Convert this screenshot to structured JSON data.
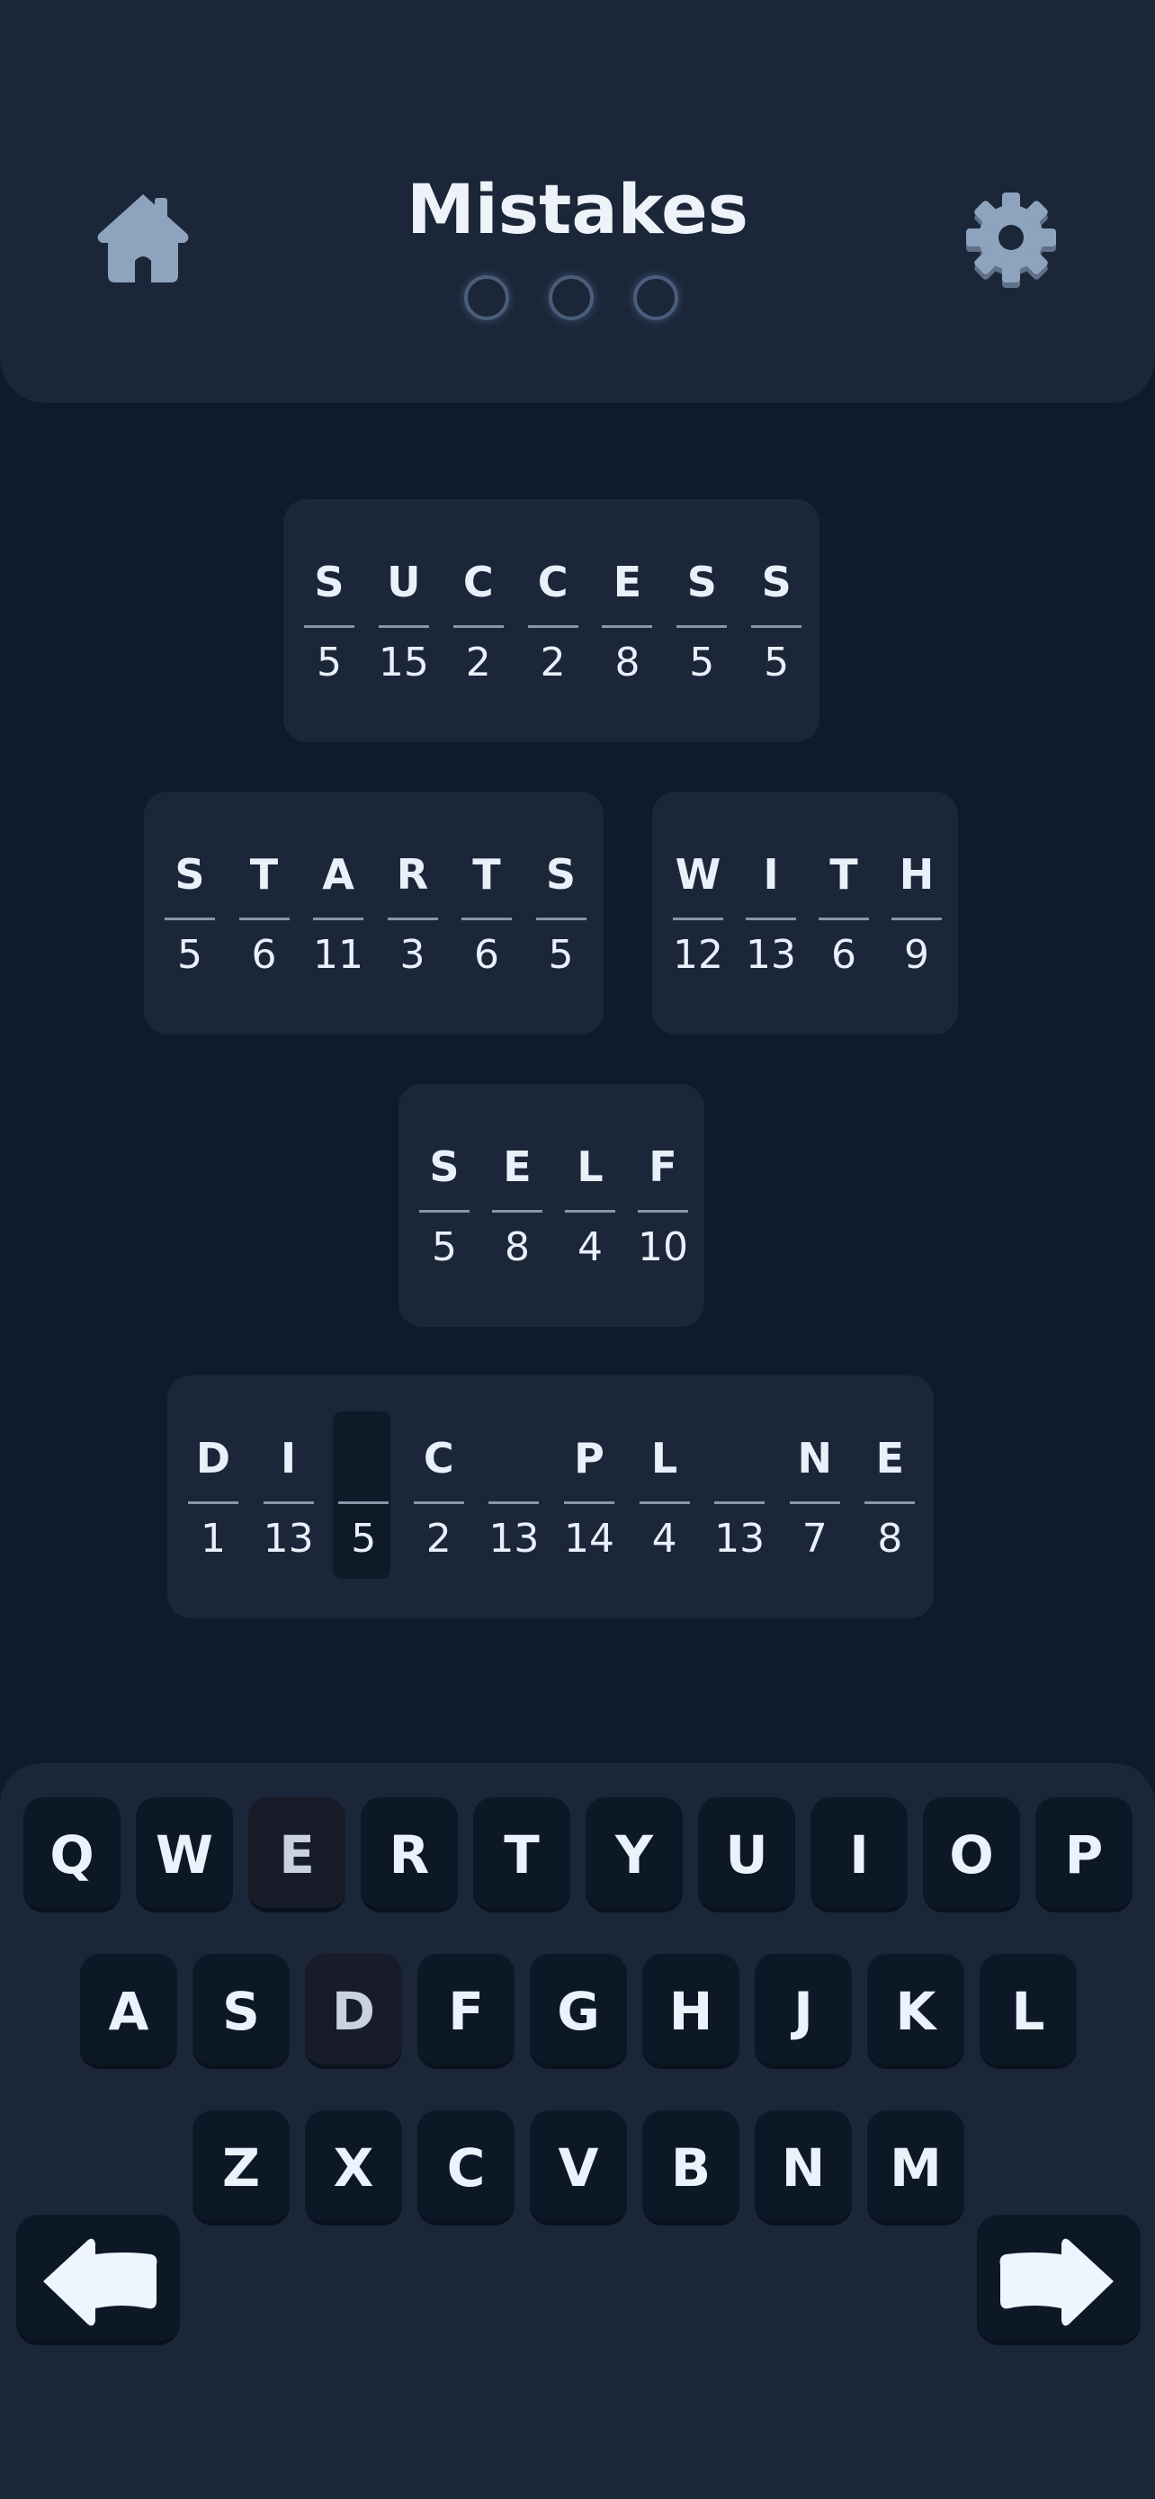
{
  "header": {
    "title": "Mistakes",
    "mistakes": [
      false,
      false,
      false
    ],
    "icons": {
      "home": "home-icon",
      "settings": "gear-icon"
    }
  },
  "puzzle": {
    "words": [
      {
        "cells": [
          {
            "letter": "S",
            "number": "5"
          },
          {
            "letter": "U",
            "number": "15"
          },
          {
            "letter": "C",
            "number": "2"
          },
          {
            "letter": "C",
            "number": "2"
          },
          {
            "letter": "E",
            "number": "8"
          },
          {
            "letter": "S",
            "number": "5"
          },
          {
            "letter": "S",
            "number": "5"
          }
        ]
      },
      {
        "cells": [
          {
            "letter": "S",
            "number": "5"
          },
          {
            "letter": "T",
            "number": "6"
          },
          {
            "letter": "A",
            "number": "11"
          },
          {
            "letter": "R",
            "number": "3"
          },
          {
            "letter": "T",
            "number": "6"
          },
          {
            "letter": "S",
            "number": "5"
          }
        ]
      },
      {
        "cells": [
          {
            "letter": "W",
            "number": "12"
          },
          {
            "letter": "I",
            "number": "13"
          },
          {
            "letter": "T",
            "number": "6"
          },
          {
            "letter": "H",
            "number": "9"
          }
        ]
      },
      {
        "cells": [
          {
            "letter": "S",
            "number": "5"
          },
          {
            "letter": "E",
            "number": "8"
          },
          {
            "letter": "L",
            "number": "4"
          },
          {
            "letter": "F",
            "number": "10"
          }
        ]
      },
      {
        "cells": [
          {
            "letter": "D",
            "number": "1"
          },
          {
            "letter": "I",
            "number": "13"
          },
          {
            "letter": "",
            "number": "5",
            "active": true
          },
          {
            "letter": "C",
            "number": "2"
          },
          {
            "letter": "",
            "number": "13"
          },
          {
            "letter": "P",
            "number": "14"
          },
          {
            "letter": "L",
            "number": "4"
          },
          {
            "letter": "",
            "number": "13"
          },
          {
            "letter": "N",
            "number": "7"
          },
          {
            "letter": "E",
            "number": "8"
          }
        ]
      }
    ]
  },
  "keyboard": {
    "rows": [
      [
        "Q",
        "W",
        "E",
        "R",
        "T",
        "Y",
        "U",
        "I",
        "O",
        "P"
      ],
      [
        "A",
        "S",
        "D",
        "F",
        "G",
        "H",
        "J",
        "K",
        "L"
      ],
      [
        "Z",
        "X",
        "C",
        "V",
        "B",
        "N",
        "M"
      ]
    ],
    "used_keys": [
      "E",
      "D"
    ],
    "icons": {
      "left": "arrow-left-icon",
      "right": "arrow-right-icon"
    }
  },
  "colors": {
    "background": "#0d1b2b",
    "panel": "#1c2639",
    "key": "#0d1826",
    "text": "#e8f0fa"
  }
}
